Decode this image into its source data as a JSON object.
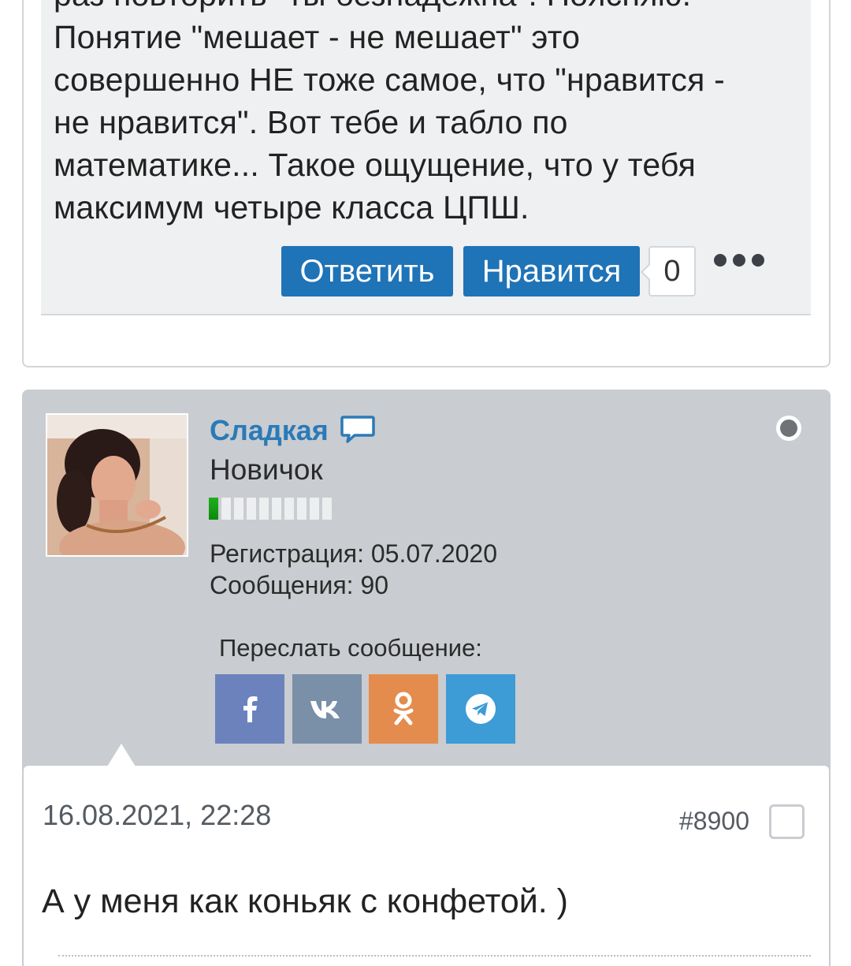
{
  "previous_post": {
    "text_lines": [
      "раз повторить \"ты безнадежна\". Поясняю.",
      "Понятие \"мешает - не мешает\" это",
      "совершенно НЕ тоже самое, что \"нравится -",
      "не нравится\". Вот тебе и табло по",
      "математике... Такое ощущение, что у тебя",
      "максимум четыре класса ЦПШ."
    ],
    "reply_label": "Ответить",
    "like_label": "Нравится",
    "like_count": "0"
  },
  "post": {
    "username": "Сладкая",
    "rank": "Новичок",
    "reputation": {
      "filled": 1,
      "total": 10
    },
    "registration": "Регистрация: 05.07.2020",
    "messages": "Сообщения: 90",
    "share_title": "Переслать сообщение:",
    "share_buttons": [
      {
        "icon": "facebook-icon",
        "color": "#6b82bd"
      },
      {
        "icon": "vk-icon",
        "color": "#7a8fa8"
      },
      {
        "icon": "odnoklassniki-icon",
        "color": "#e48c4d"
      },
      {
        "icon": "telegram-icon",
        "color": "#3d9bd6"
      }
    ],
    "date": "16.08.2021, 22:28",
    "number": "#8900",
    "text": "А у меня как коньяк с конфетой. )"
  },
  "colors": {
    "accent": "#1f73b7",
    "username": "#2a7ab8",
    "post_header_bg": "#c9ccd0"
  }
}
